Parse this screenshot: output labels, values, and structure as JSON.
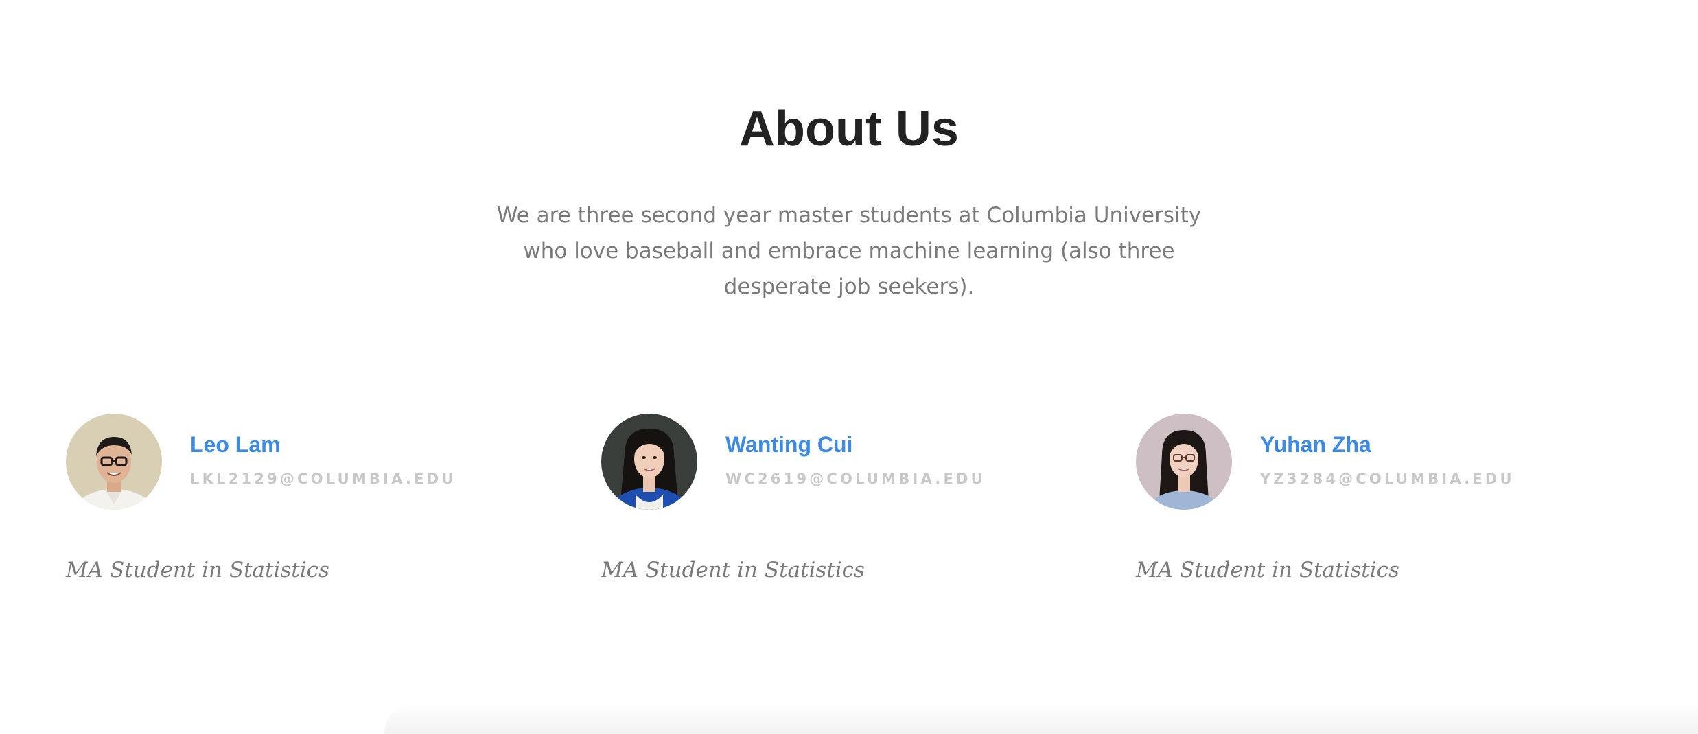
{
  "about": {
    "title": "About Us",
    "description": "We are three second year master students at Columbia University who love baseball and embrace machine learning (also three desperate job seekers)."
  },
  "members": [
    {
      "name": "Leo Lam",
      "email": "LKL2129@COLUMBIA.EDU",
      "role": "MA Student in Statistics"
    },
    {
      "name": "Wanting Cui",
      "email": "WC2619@COLUMBIA.EDU",
      "role": "MA Student in Statistics"
    },
    {
      "name": "Yuhan Zha",
      "email": "YZ3284@COLUMBIA.EDU",
      "role": "MA Student in Statistics"
    }
  ],
  "colors": {
    "name_link": "#3b8ae6",
    "email_text": "#c8c8c8",
    "body_text": "#7a7a7a",
    "heading_text": "#222222"
  }
}
